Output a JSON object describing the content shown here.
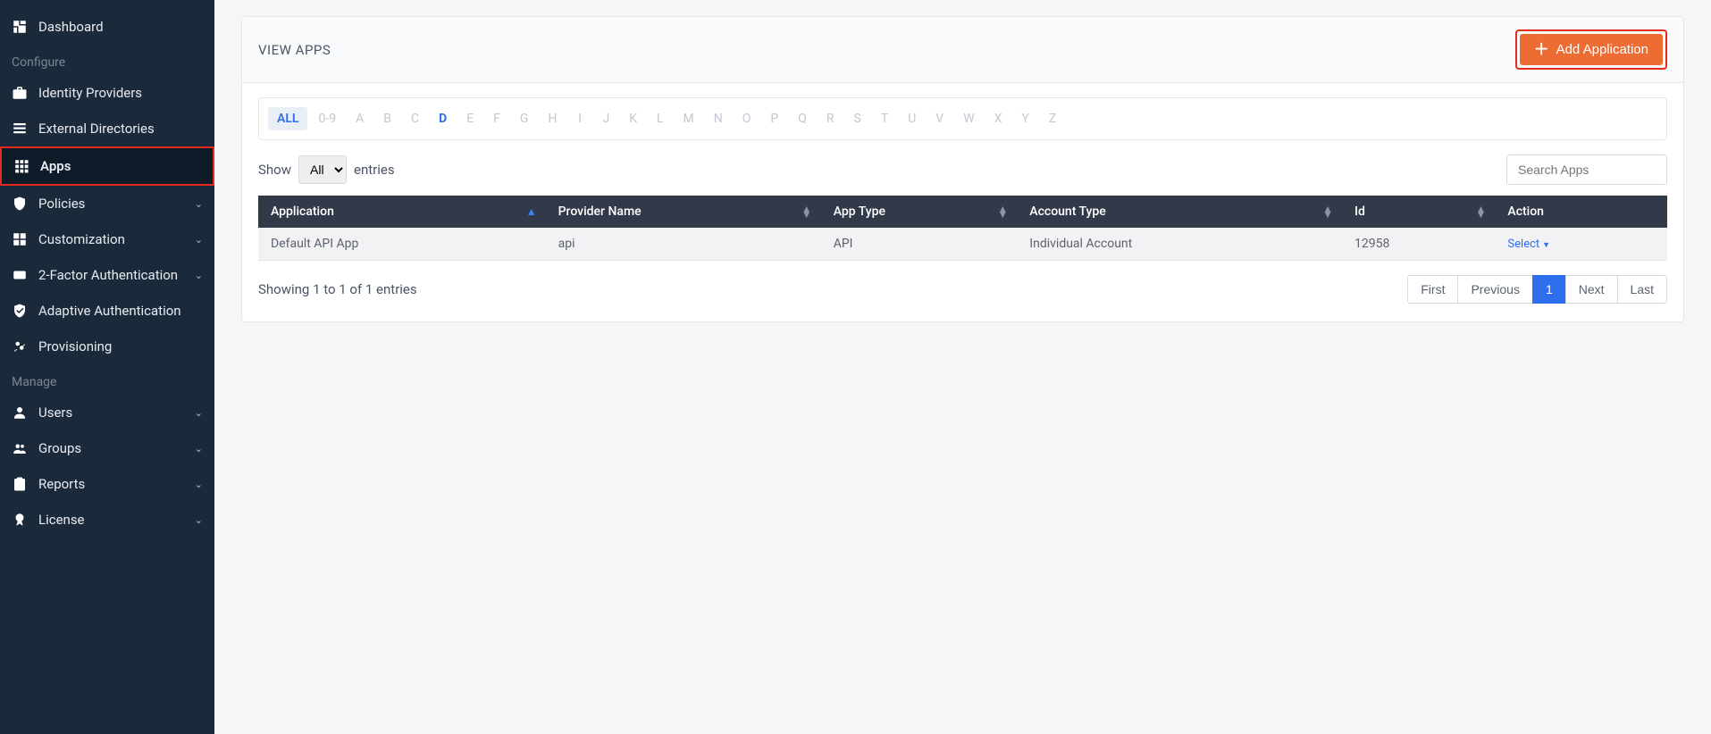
{
  "sidebar": {
    "sections": {
      "configure": "Configure",
      "manage": "Manage"
    },
    "items": {
      "dashboard": "Dashboard",
      "idp": "Identity Providers",
      "extdir": "External Directories",
      "apps": "Apps",
      "policies": "Policies",
      "customization": "Customization",
      "twofa": "2-Factor Authentication",
      "adaptive": "Adaptive Authentication",
      "provisioning": "Provisioning",
      "users": "Users",
      "groups": "Groups",
      "reports": "Reports",
      "license": "License"
    }
  },
  "header": {
    "title": "VIEW APPS",
    "add_button": "Add Application"
  },
  "filters": [
    "ALL",
    "0-9",
    "A",
    "B",
    "C",
    "D",
    "E",
    "F",
    "G",
    "H",
    "I",
    "J",
    "K",
    "L",
    "M",
    "N",
    "O",
    "P",
    "Q",
    "R",
    "S",
    "T",
    "U",
    "V",
    "W",
    "X",
    "Y",
    "Z"
  ],
  "table_controls": {
    "show_label": "Show",
    "entries_label": "entries",
    "selected_length": "All",
    "search_placeholder": "Search Apps"
  },
  "columns": {
    "application": "Application",
    "provider": "Provider Name",
    "apptype": "App Type",
    "accounttype": "Account Type",
    "id": "Id",
    "action": "Action"
  },
  "rows": [
    {
      "application": "Default API App",
      "provider": "api",
      "apptype": "API",
      "accounttype": "Individual Account",
      "id": "12958",
      "action": "Select"
    }
  ],
  "footer": {
    "info": "Showing 1 to 1 of 1 entries",
    "pages": {
      "first": "First",
      "prev": "Previous",
      "current": "1",
      "next": "Next",
      "last": "Last"
    }
  }
}
